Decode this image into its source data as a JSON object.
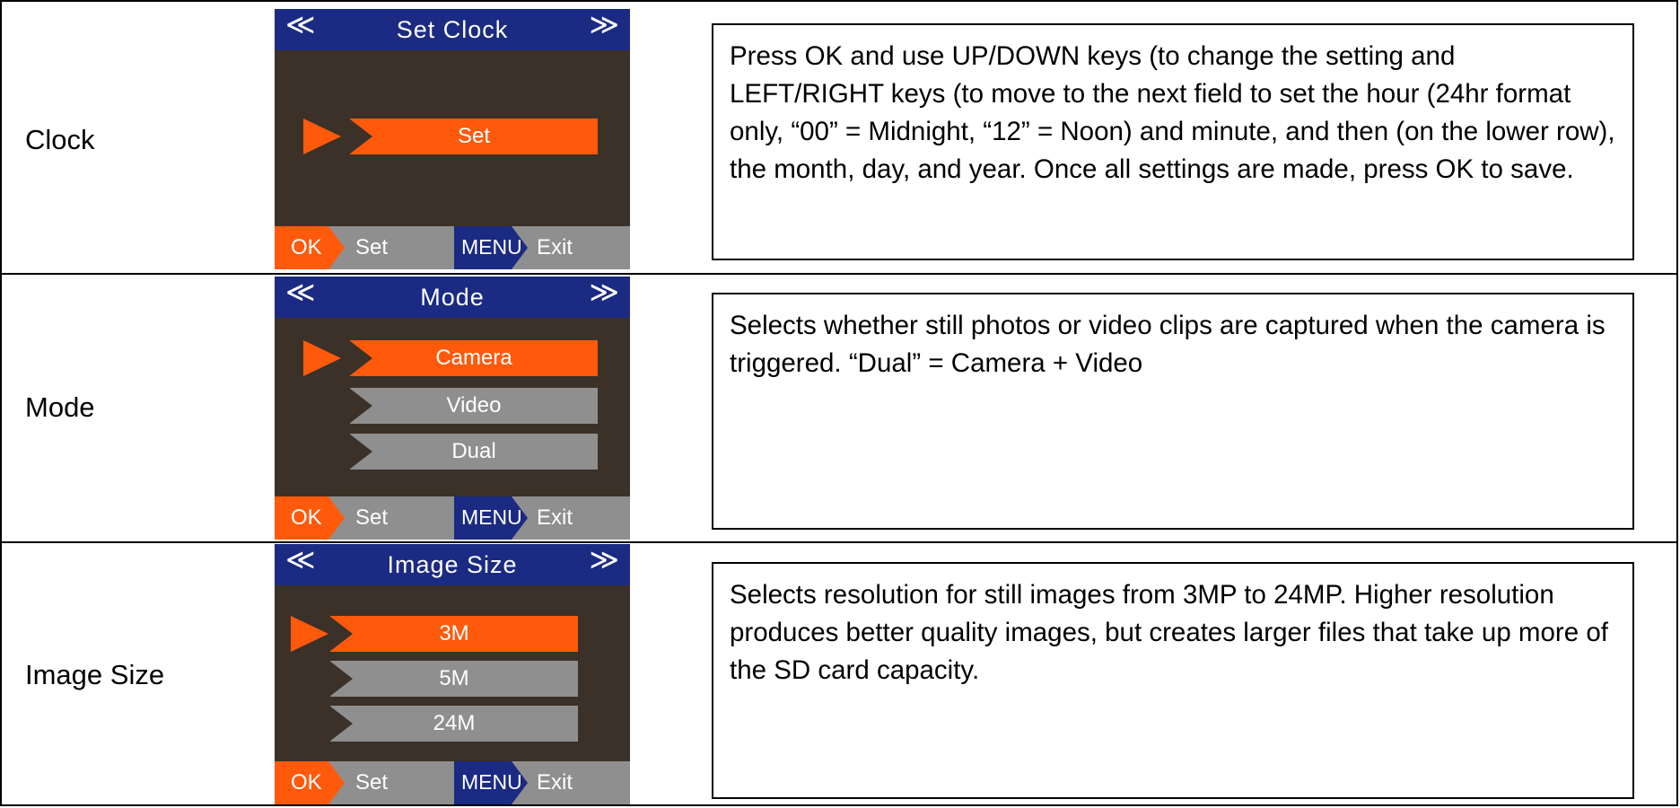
{
  "rows": [
    {
      "label": "Clock",
      "screen": {
        "title": "Set Clock",
        "left_arrow": "≪",
        "right_arrow": "≫",
        "options": [
          {
            "text": "Set",
            "selected": true
          }
        ],
        "ok_key": "OK",
        "ok_action": "Set",
        "menu_key": "MENU",
        "menu_action": "Exit"
      },
      "description": "Press OK and use UP/DOWN keys (to change the setting and LEFT/RIGHT keys (to move to the next field to set the hour (24hr format only, “00” = Midnight, “12” = Noon) and minute, and then (on the lower row), the month, day, and year.  Once all settings are made, press OK to save."
    },
    {
      "label": "Mode",
      "screen": {
        "title": "Mode",
        "left_arrow": "≪",
        "right_arrow": "≫",
        "options": [
          {
            "text": "Camera",
            "selected": true
          },
          {
            "text": "Video",
            "selected": false
          },
          {
            "text": "Dual",
            "selected": false
          }
        ],
        "ok_key": "OK",
        "ok_action": "Set",
        "menu_key": "MENU",
        "menu_action": "Exit"
      },
      "description": "Selects whether still photos or video clips are captured when the camera is triggered.  “Dual” = Camera + Video"
    },
    {
      "label": "Image Size",
      "screen": {
        "title": "Image Size",
        "left_arrow": "≪",
        "right_arrow": "≫",
        "options": [
          {
            "text": "3M",
            "selected": true
          },
          {
            "text": "5M",
            "selected": false
          },
          {
            "text": "24M",
            "selected": false
          }
        ],
        "ok_key": "OK",
        "ok_action": "Set",
        "menu_key": "MENU",
        "menu_action": "Exit"
      },
      "description": "Selects resolution for still images from 3MP to 24MP.  Higher resolution produces better quality images, but creates larger files that take up more of the SD card capacity."
    }
  ],
  "colors": {
    "screen_bg": "#3b3128",
    "title_bar": "#1b2a82",
    "accent_orange": "#ff5a0c",
    "inactive_gray": "#8f8f8f"
  }
}
